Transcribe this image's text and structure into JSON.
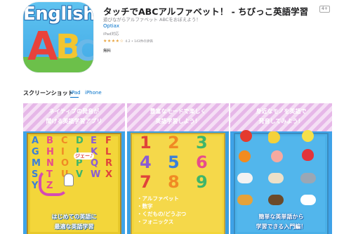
{
  "app": {
    "title": "タッチでABCアルファベット！ - ちびっこ英語学習",
    "age_rating": "4+",
    "subtitle": "遊びながらアルファベット ABCをおぼえよう！",
    "developer": "Optiax",
    "compatibility": "iPad対応",
    "rating_stars": "★★★★☆",
    "rating_text": "4.2 • 143件の評価",
    "price": "無料",
    "icon": {
      "word": "English",
      "letters": [
        "A",
        "B",
        "C"
      ]
    }
  },
  "screenshots": {
    "section_title": "スクリーンショット",
    "tabs": [
      {
        "label": "iPad",
        "active": true
      },
      {
        "label": "iPhone",
        "active": false
      }
    ],
    "items": [
      {
        "header_lines": [
          "ネイティブの発音が",
          "聞ける英語学習アプリ"
        ],
        "letters": [
          "A",
          "B",
          "C",
          "D",
          "E",
          "F",
          "G",
          "H",
          "I",
          "J",
          "K",
          "L",
          "M",
          "N",
          "O",
          "P",
          "Q",
          "R",
          "S",
          "T",
          "U",
          "V",
          "W",
          "X",
          "Y",
          "Z"
        ],
        "bubble": "ジェー♪",
        "captions": [
          "はじめての英語に",
          "最適な英語学習"
        ]
      },
      {
        "header_lines": [
          "豊富なモードで楽しく",
          "英語学習しよう！"
        ],
        "numbers": [
          "1",
          "2",
          "3",
          "4",
          "5",
          "6",
          "7",
          "8",
          "9"
        ],
        "list": [
          "・アルファベット",
          "・数字",
          "・くだもの/どうぶつ",
          "・フォニックス"
        ]
      },
      {
        "header_lines": [
          "身近なモノを英語で",
          "発音してみよう！"
        ],
        "captions": [
          "簡単な英単語から",
          "学習できる入門編！"
        ]
      }
    ]
  },
  "colors": {
    "link": "#0070c9",
    "star": "#e8a33d",
    "board": "#f3d63a"
  }
}
